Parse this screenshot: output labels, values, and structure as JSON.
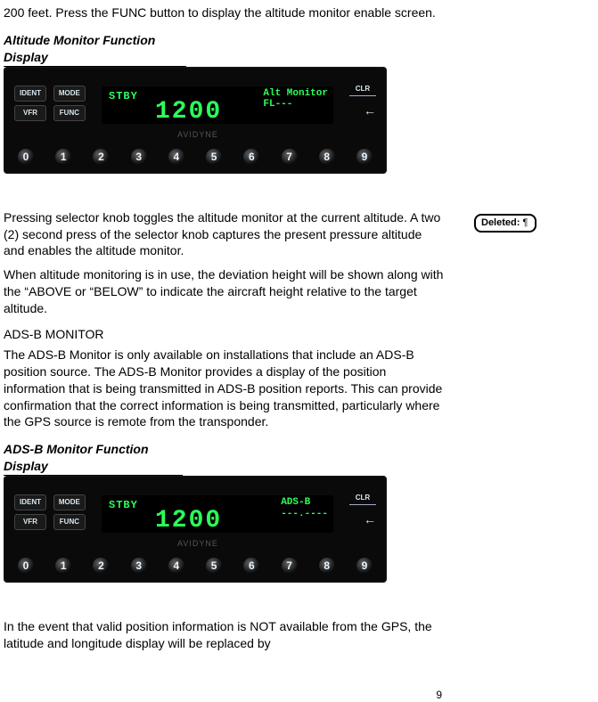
{
  "para_top": "200 feet.  Press the FUNC button to display the altitude monitor enable screen.",
  "caption1": "Altitude Monitor Function Display",
  "device1": {
    "btn_ident": "IDENT",
    "btn_mode": "MODE",
    "btn_vfr": "VFR",
    "btn_func": "FUNC",
    "btn_clr": "CLR",
    "disp_stby": "STBY",
    "disp_big": "1200",
    "disp_right_line1": "Alt Monitor",
    "disp_right_line2": "FL---",
    "brand": "AVIDYNE",
    "digits": [
      "0",
      "1",
      "2",
      "3",
      "4",
      "5",
      "6",
      "7",
      "8",
      "9"
    ]
  },
  "para2": " Pressing selector knob toggles the altitude monitor at the current altitude. A two (2) second press of the selector knob captures the present pressure altitude and enables the altitude monitor.",
  "para3": "When altitude monitoring is in use, the deviation height will be shown along with the “ABOVE or “BELOW” to indicate the aircraft height relative to the target altitude.",
  "heading1": "ADS-B MONITOR",
  "para4": "The ADS-B Monitor is only available on installations that include an ADS-B position source.  The ADS-B Monitor provides a display of the position information that is being transmitted in ADS-B position reports.  This can provide confirmation that the correct information is being transmitted, particularly where the GPS source is remote from the transponder.",
  "caption2": "ADS-B Monitor Function Display",
  "device2": {
    "btn_ident": "IDENT",
    "btn_mode": "MODE",
    "btn_vfr": "VFR",
    "btn_func": "FUNC",
    "btn_clr": "CLR",
    "disp_stby": "STBY",
    "disp_big": "1200",
    "disp_right_line1": "ADS-B",
    "disp_right_line2": "---.----",
    "brand": "AVIDYNE",
    "digits": [
      "0",
      "1",
      "2",
      "3",
      "4",
      "5",
      "6",
      "7",
      "8",
      "9"
    ]
  },
  "para5": "In the event that valid position information is NOT available from the GPS, the latitude and longitude display will be replaced by",
  "page_number": "9",
  "revision": {
    "label": "Deleted: ",
    "mark": "¶"
  }
}
